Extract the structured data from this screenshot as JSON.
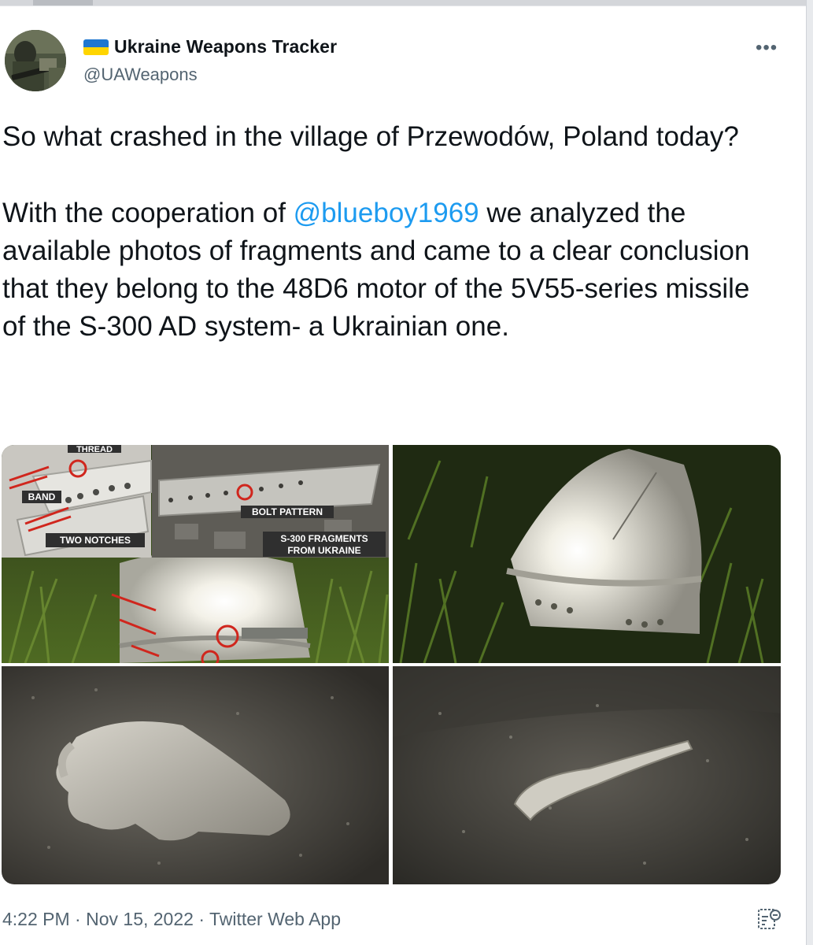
{
  "account": {
    "display_name": "Ukraine Weapons Tracker",
    "handle": "@UAWeapons",
    "flag_colors": {
      "top": "#1f77d0",
      "bottom": "#ffd500"
    }
  },
  "tweet": {
    "paragraph1": "So what crashed in the village of Przewodów, Poland today?",
    "paragraph2_before": "With the cooperation of ",
    "mention": "@blueboy1969",
    "paragraph2_after": " we analyzed the available photos of fragments and came to a clear conclusion that they belong to the 48D6 motor of the 5V55-series missile of the S-300 AD system- a Ukrainian one."
  },
  "media": {
    "photo1_labels": {
      "thread": "THREAD",
      "band": "BAND",
      "two_notches": "TWO NOTCHES",
      "bolt_pattern": "BOLT PATTERN",
      "fragments_line1": "S-300 FRAGMENTS",
      "fragments_line2": "FROM UKRAINE"
    }
  },
  "meta": {
    "time": "4:22 PM",
    "separator": " · ",
    "date": "Nov 15, 2022",
    "source": "Twitter Web App"
  },
  "colors": {
    "link": "#1d9bf0",
    "secondary_text": "#536471",
    "primary_text": "#0f1419",
    "annotation_red": "#d0261d"
  },
  "icons": [
    "more-options-icon",
    "ukraine-flag-icon",
    "analytics-icon"
  ]
}
